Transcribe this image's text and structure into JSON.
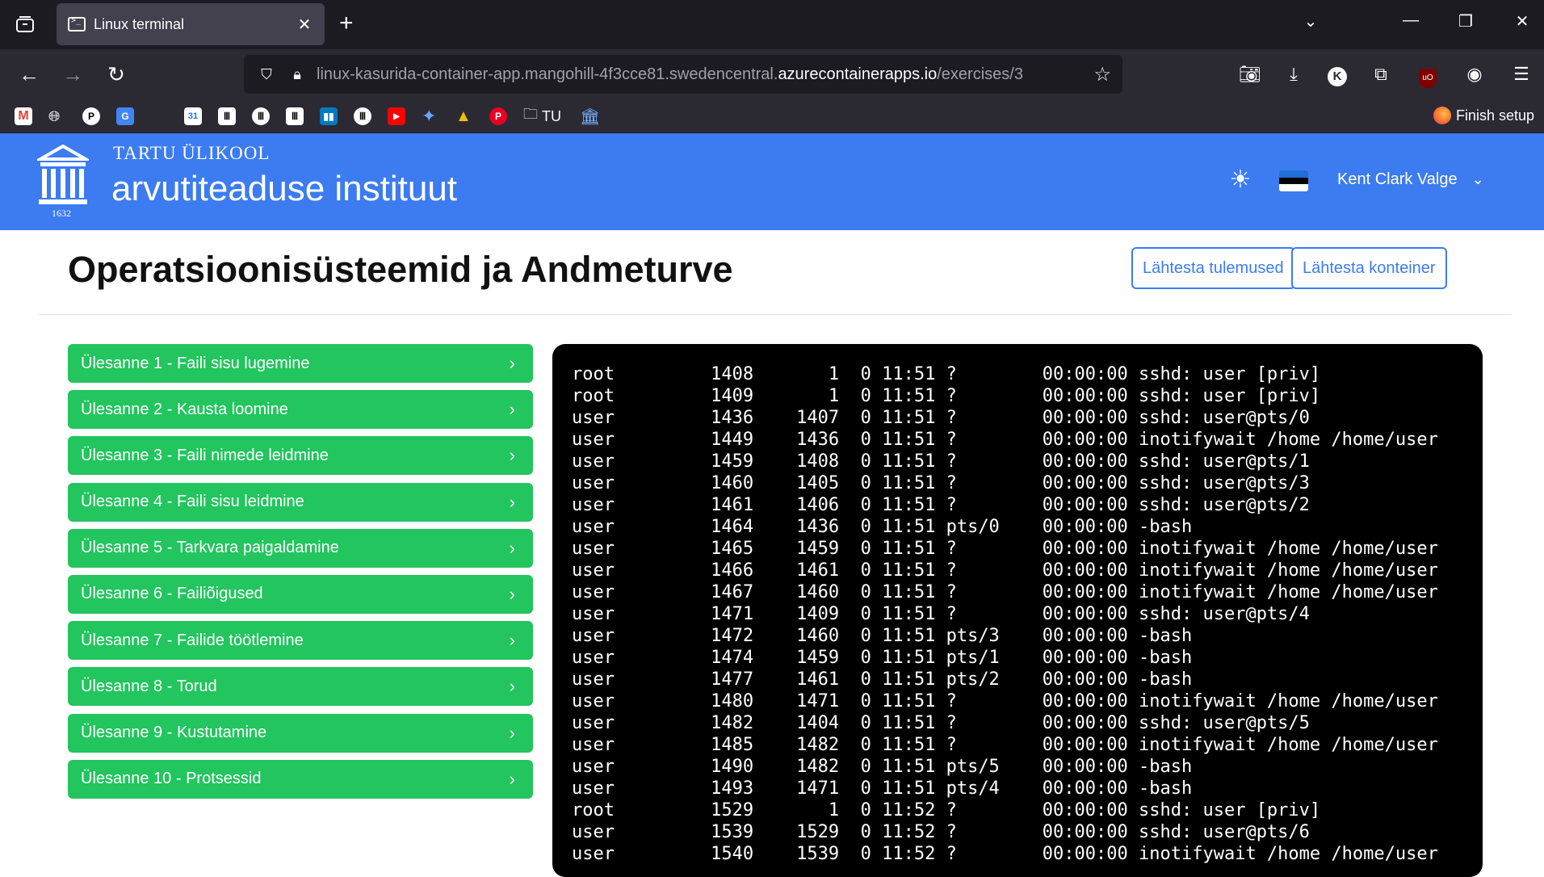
{
  "browser": {
    "tab_title": "Linux terminal",
    "url_prefix": "linux-kasurida-container-app.mangohill-4f3cce81.swedencentral.",
    "url_domain": "azurecontainerapps.io",
    "url_path": "/exercises/3",
    "bookmarks": {
      "folder_label": "TU",
      "finish_setup": "Finish setup"
    }
  },
  "header": {
    "university": "TARTU ÜLIKOOL",
    "institute": "arvutiteaduse instituut",
    "year": "1632",
    "user_name": "Kent Clark Valge"
  },
  "page": {
    "title": "Operatsioonisüsteemid ja Andmeturve",
    "reset_results_label": "Lähtesta tulemused",
    "reset_container_label": "Lähtesta konteiner"
  },
  "tasks": [
    "Ülesanne 1 - Faili sisu lugemine",
    "Ülesanne 2 - Kausta loomine",
    "Ülesanne 3 - Faili nimede leidmine",
    "Ülesanne 4 - Faili sisu leidmine",
    "Ülesanne 5 - Tarkvara paigaldamine",
    "Ülesanne 6 - Failiõigused",
    "Ülesanne 7 - Failide töötlemine",
    "Ülesanne 8 - Torud",
    "Ülesanne 9 - Kustutamine",
    "Ülesanne 10 - Protsessid"
  ],
  "terminal": {
    "lines": [
      "root         1408       1  0 11:51 ?        00:00:00 sshd: user [priv]",
      "root         1409       1  0 11:51 ?        00:00:00 sshd: user [priv]",
      "user         1436    1407  0 11:51 ?        00:00:00 sshd: user@pts/0",
      "user         1449    1436  0 11:51 ?        00:00:00 inotifywait /home /home/user",
      "user         1459    1408  0 11:51 ?        00:00:00 sshd: user@pts/1",
      "user         1460    1405  0 11:51 ?        00:00:00 sshd: user@pts/3",
      "user         1461    1406  0 11:51 ?        00:00:00 sshd: user@pts/2",
      "user         1464    1436  0 11:51 pts/0    00:00:00 -bash",
      "user         1465    1459  0 11:51 ?        00:00:00 inotifywait /home /home/user",
      "user         1466    1461  0 11:51 ?        00:00:00 inotifywait /home /home/user",
      "user         1467    1460  0 11:51 ?        00:00:00 inotifywait /home /home/user",
      "user         1471    1409  0 11:51 ?        00:00:00 sshd: user@pts/4",
      "user         1472    1460  0 11:51 pts/3    00:00:00 -bash",
      "user         1474    1459  0 11:51 pts/1    00:00:00 -bash",
      "user         1477    1461  0 11:51 pts/2    00:00:00 -bash",
      "user         1480    1471  0 11:51 ?        00:00:00 inotifywait /home /home/user",
      "user         1482    1404  0 11:51 ?        00:00:00 sshd: user@pts/5",
      "user         1485    1482  0 11:51 ?        00:00:00 inotifywait /home /home/user",
      "user         1490    1482  0 11:51 pts/5    00:00:00 -bash",
      "user         1493    1471  0 11:51 pts/4    00:00:00 -bash",
      "root         1529       1  0 11:52 ?        00:00:00 sshd: user [priv]",
      "user         1539    1529  0 11:52 ?        00:00:00 sshd: user@pts/6",
      "user         1540    1539  0 11:52 ?        00:00:00 inotifywait /home /home/user"
    ]
  },
  "colors": {
    "header_blue": "#3c7cf0",
    "task_green": "#22c55e",
    "terminal_bg": "#000000"
  }
}
